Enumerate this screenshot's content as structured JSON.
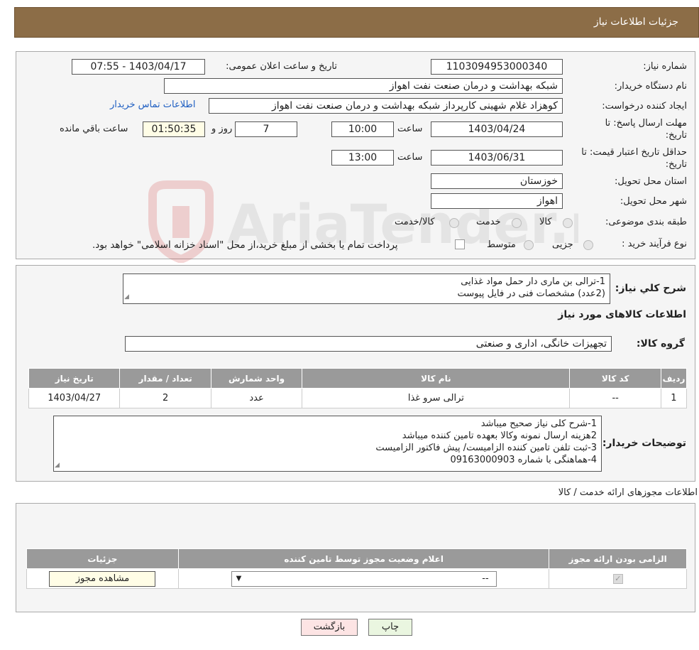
{
  "header": {
    "title": "جزئیات اطلاعات نیاز"
  },
  "info": {
    "need_number_label": "شماره نیاز:",
    "need_number": "1103094953000340",
    "announce_label": "تاریخ و ساعت اعلان عمومی:",
    "announce_value": "1403/04/17 - 07:55",
    "buyer_label": "نام دستگاه خریدار:",
    "buyer_value": "شبکه بهداشت و درمان صنعت نفت اهواز",
    "creator_label": "ایجاد کننده درخواست:",
    "creator_value": "کوهزاد غلام شهینی کارپرداز شبکه بهداشت و درمان صنعت نفت اهواز",
    "contact_link": "اطلاعات تماس خریدار",
    "deadline_label_1": "مهلت ارسال پاسخ: تا",
    "deadline_label_2": "تاریخ:",
    "deadline_date": "1403/04/24",
    "time_label": "ساعت",
    "deadline_time": "10:00",
    "days_value": "7",
    "days_label": "روز و",
    "remaining_time": "01:50:35",
    "remaining_label": "ساعت باقي مانده",
    "validity_label_1": "حداقل تاریخ اعتبار قیمت: تا",
    "validity_label_2": "تاریخ:",
    "validity_date": "1403/06/31",
    "validity_time": "13:00",
    "province_label": "استان محل تحویل:",
    "province_value": "خوزستان",
    "city_label": "شهر محل تحویل:",
    "city_value": "اهواز",
    "category_label": "طبقه بندی موضوعی:",
    "category_options": [
      "کالا",
      "خدمت",
      "کالا/خدمت"
    ],
    "process_label": "نوع فرآیند خرید :",
    "process_options": [
      "جزیی",
      "متوسط"
    ],
    "process_note": "پرداخت تمام یا بخشی از مبلغ خرید،از محل \"اسناد خزانه اسلامی\" خواهد بود."
  },
  "watermark": {
    "text": "AriaTender.neT"
  },
  "description": {
    "label": "شرح کلي نیاز:",
    "lines": [
      "1-ترالی بن ماری دار حمل مواد غذایی",
      "(2عدد) مشخصات فنی در فایل پیوست"
    ]
  },
  "goods": {
    "section_title": "اطلاعات کالاهای مورد نیاز",
    "group_label": "گروه کالا:",
    "group_value": "تجهیزات خانگی، اداری و صنعتی",
    "columns": [
      "ردیف",
      "کد کالا",
      "نام کالا",
      "واحد شمارش",
      "تعداد / مقدار",
      "تاریخ نیاز"
    ],
    "rows": [
      [
        "1",
        "--",
        "ترالی سرو غذا",
        "عدد",
        "2",
        "1403/04/27"
      ]
    ]
  },
  "buyer_notes": {
    "label": "توضیحات خریدار:",
    "lines": [
      "1-شرح کلی نیاز صحیح میباشد",
      "2هزینه ارسال نمونه وکالا بعهده تامین کننده میباشد",
      "3-ثبت تلفن تامین کننده الزامیست/ پیش فاکتور الزامیست",
      "4-هماهنگی با شماره 09163000903"
    ]
  },
  "permits": {
    "section_title": "اطلاعات مجوزهای ارائه خدمت / کالا",
    "columns": [
      "الزامی بودن ارائه مجوز",
      "اعلام وضعیت مجوز توسط تامین کننده",
      "جزئیات"
    ],
    "select_value": "--",
    "view_button": "مشاهده مجوز"
  },
  "footer": {
    "print_label": "چاپ",
    "back_label": "بازگشت"
  },
  "colors": {
    "header_bg": "#8c6d47",
    "table_header": "#9a9a9a",
    "back_btn": "#fde4e4",
    "print_btn": "#eaf6e0"
  }
}
